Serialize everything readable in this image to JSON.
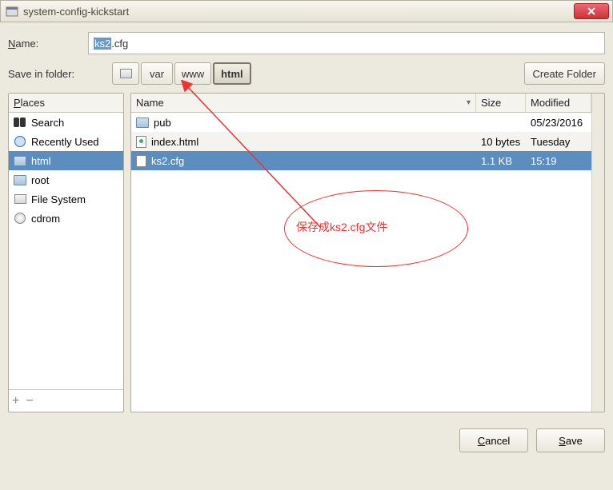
{
  "window": {
    "title": "system-config-kickstart"
  },
  "name_row": {
    "label_pre": "N",
    "label_rest": "ame:",
    "input_selected": "ks2",
    "input_rest": ".cfg"
  },
  "folder_row": {
    "label": "Save in folder:",
    "crumbs": [
      "var",
      "www",
      "html"
    ],
    "create_label": "Create Folder"
  },
  "places": {
    "header_pre": "P",
    "header_rest": "laces",
    "items": [
      {
        "icon": "binoculars-icon",
        "label": "Search"
      },
      {
        "icon": "clock-icon",
        "label": "Recently Used"
      },
      {
        "icon": "folder-icon",
        "label": "html",
        "selected": true
      },
      {
        "icon": "folder-icon",
        "label": "root"
      },
      {
        "icon": "drive-icon",
        "label": "File System"
      },
      {
        "icon": "disc-icon",
        "label": "cdrom"
      }
    ]
  },
  "files": {
    "columns": {
      "name": "Name",
      "size": "Size",
      "modified": "Modified"
    },
    "rows": [
      {
        "icon": "folder-icon",
        "name": "pub",
        "size": "",
        "modified": "05/23/2016"
      },
      {
        "icon": "html-file-icon",
        "name": "index.html",
        "size": "10 bytes",
        "modified": "Tuesday"
      },
      {
        "icon": "text-file-icon",
        "name": "ks2.cfg",
        "size": "1.1 KB",
        "modified": "15:19",
        "selected": true
      }
    ]
  },
  "footer": {
    "cancel_pre": "C",
    "cancel_rest": "ancel",
    "save_pre": "S",
    "save_rest": "ave"
  },
  "annotation": {
    "text": "保存成ks2.cfg文件"
  }
}
